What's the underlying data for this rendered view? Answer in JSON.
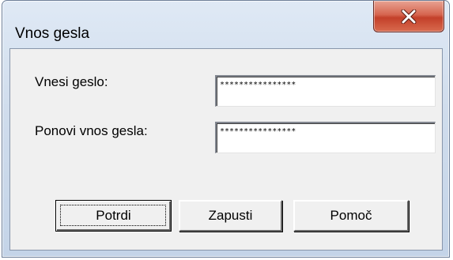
{
  "window": {
    "title": "Vnos gesla",
    "close_icon": "close-icon"
  },
  "form": {
    "password_label": "Vnesi geslo:",
    "password_value": "****************",
    "confirm_label": "Ponovi vnos gesla:",
    "confirm_value": "****************"
  },
  "buttons": {
    "confirm_label": "Potrdi",
    "run_label": "Zapusti",
    "help_label": "Pomoč"
  }
}
